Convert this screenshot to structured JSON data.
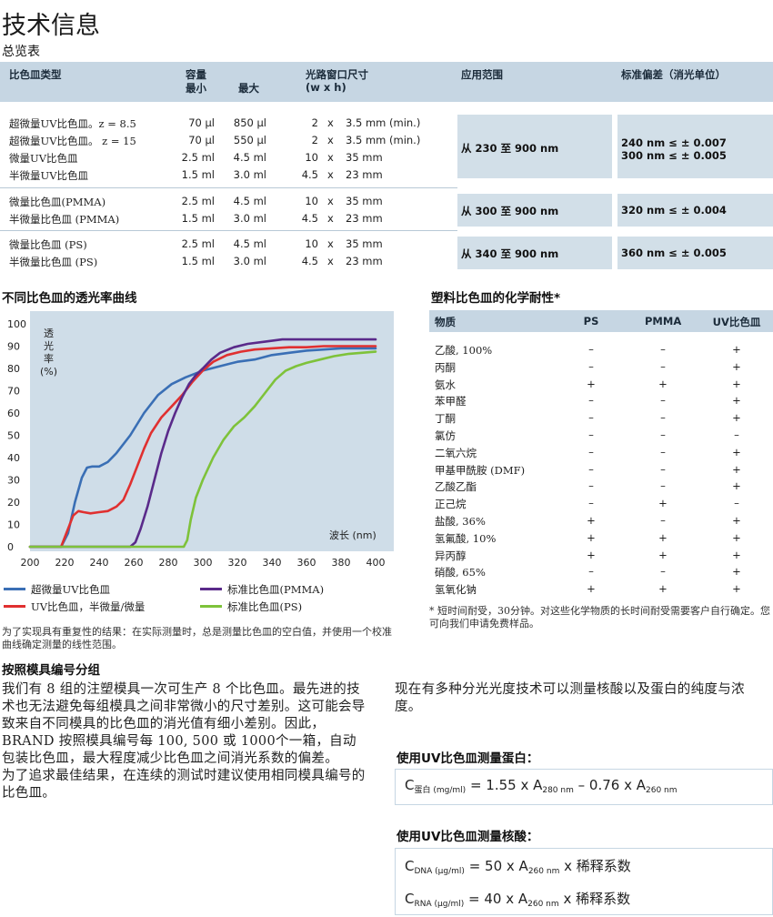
{
  "title": "技术信息",
  "subtitle": "总览表",
  "overview": {
    "headers": {
      "type": "比色皿类型",
      "capacity": "容量",
      "min": "最小",
      "max": "最大",
      "window": "光路窗口尺寸",
      "window_unit": "(w x h)",
      "range": "应用范围",
      "deviation": "标准偏差（消光单位）"
    },
    "rows": [
      {
        "name": "超微量UV比色皿。z = 8.5",
        "min": "70 µl",
        "max": "850 µl",
        "w": "2",
        "x": "x",
        "h": "3.5 mm (min.)"
      },
      {
        "name": "超微量UV比色皿。 z = 15",
        "min": "70 µl",
        "max": "550 µl",
        "w": "2",
        "x": "x",
        "h": "3.5 mm (min.)"
      },
      {
        "name": "微量UV比色皿",
        "min": "2.5 ml",
        "max": "4.5 ml",
        "w": "10",
        "x": "x",
        "h": "35 mm"
      },
      {
        "name": "半微量UV比色皿",
        "min": "1.5 ml",
        "max": "3.0 ml",
        "w": "4.5",
        "x": "x",
        "h": "23 mm"
      },
      {
        "name": "微量比色皿(PMMA)",
        "min": "2.5 ml",
        "max": "4.5 ml",
        "w": "10",
        "x": "x",
        "h": "35 mm"
      },
      {
        "name": "半微量比色皿 (PMMA)",
        "min": "1.5 ml",
        "max": "3.0 ml",
        "w": "4.5",
        "x": "x",
        "h": "23 mm"
      },
      {
        "name": "微量比色皿 (PS)",
        "min": "2.5 ml",
        "max": "4.5 ml",
        "w": "10",
        "x": "x",
        "h": "35 mm"
      },
      {
        "name": "半微量比色皿 (PS)",
        "min": "1.5 ml",
        "max": "3.0 ml",
        "w": "4.5",
        "x": "x",
        "h": "23 mm"
      }
    ],
    "groups": [
      {
        "range": "从 230 至 900 nm",
        "dev1": "240 nm ≤ ± 0.007",
        "dev2": "300 nm ≤ ± 0.005"
      },
      {
        "range": "从 300 至 900 nm",
        "dev1": "320 nm ≤ ± 0.004",
        "dev2": ""
      },
      {
        "range": "从 340 至 900 nm",
        "dev1": "360 nm ≤ ± 0.005",
        "dev2": ""
      }
    ]
  },
  "chart_heading": "不同比色皿的透光率曲线",
  "chart_note": "为了实现具有重复性的结果：在实际测量时，总是测量比色皿的空白值，并使用一个校准曲线确定测量的线性范围。",
  "chart_data": {
    "type": "line",
    "ylabel_lines": [
      "透",
      "光",
      "率",
      "(%)"
    ],
    "xlabel": "波长 (nm)",
    "xlim": [
      200,
      400
    ],
    "ylim": [
      0,
      100
    ],
    "xticks": [
      "200",
      "220",
      "240",
      "260",
      "280",
      "300",
      "320",
      "340",
      "360",
      "380",
      "400"
    ],
    "yticks": [
      "0",
      "10",
      "20",
      "30",
      "40",
      "50",
      "60",
      "70",
      "80",
      "90",
      "100"
    ],
    "series": [
      {
        "name": "超微量UV比色皿",
        "color": "#3a6fb5",
        "points": [
          [
            200,
            0
          ],
          [
            218,
            0
          ],
          [
            222,
            6
          ],
          [
            226,
            20
          ],
          [
            230,
            31
          ],
          [
            233,
            35.5
          ],
          [
            236,
            36
          ],
          [
            240,
            36
          ],
          [
            245,
            38
          ],
          [
            250,
            42
          ],
          [
            258,
            50
          ],
          [
            266,
            60
          ],
          [
            274,
            68
          ],
          [
            282,
            73
          ],
          [
            290,
            76
          ],
          [
            300,
            79
          ],
          [
            310,
            81
          ],
          [
            320,
            83
          ],
          [
            330,
            84
          ],
          [
            340,
            86
          ],
          [
            350,
            87
          ],
          [
            360,
            88
          ],
          [
            370,
            88.5
          ],
          [
            380,
            89
          ],
          [
            390,
            89
          ],
          [
            400,
            89
          ]
        ]
      },
      {
        "name": "UV比色皿，半微量/微量",
        "color": "#e03030",
        "points": [
          [
            200,
            0
          ],
          [
            218,
            0
          ],
          [
            222,
            8
          ],
          [
            225,
            14
          ],
          [
            228,
            16
          ],
          [
            231,
            15.5
          ],
          [
            235,
            15
          ],
          [
            240,
            15.5
          ],
          [
            245,
            16
          ],
          [
            250,
            18
          ],
          [
            254,
            21
          ],
          [
            258,
            28
          ],
          [
            262,
            36
          ],
          [
            266,
            44
          ],
          [
            270,
            51
          ],
          [
            276,
            58
          ],
          [
            282,
            63
          ],
          [
            288,
            68
          ],
          [
            294,
            74
          ],
          [
            300,
            79
          ],
          [
            306,
            83
          ],
          [
            314,
            86
          ],
          [
            322,
            87.5
          ],
          [
            330,
            88.5
          ],
          [
            340,
            89
          ],
          [
            350,
            89.5
          ],
          [
            360,
            89.5
          ],
          [
            370,
            90
          ],
          [
            380,
            90
          ],
          [
            390,
            90
          ],
          [
            400,
            90
          ]
        ]
      },
      {
        "name": "标准比色皿(PMMA)",
        "color": "#5a2a8a",
        "points": [
          [
            200,
            0
          ],
          [
            258,
            0
          ],
          [
            261,
            2
          ],
          [
            264,
            8
          ],
          [
            268,
            18
          ],
          [
            272,
            30
          ],
          [
            276,
            42
          ],
          [
            280,
            52
          ],
          [
            284,
            60
          ],
          [
            288,
            67
          ],
          [
            292,
            73
          ],
          [
            296,
            77
          ],
          [
            300,
            80
          ],
          [
            305,
            84
          ],
          [
            310,
            87
          ],
          [
            318,
            89.5
          ],
          [
            326,
            91
          ],
          [
            336,
            92
          ],
          [
            346,
            93
          ],
          [
            356,
            93
          ],
          [
            366,
            93
          ],
          [
            380,
            93
          ],
          [
            400,
            93
          ]
        ]
      },
      {
        "name": "标准比色皿(PS)",
        "color": "#7ec23a",
        "points": [
          [
            200,
            0
          ],
          [
            289,
            0
          ],
          [
            291,
            3
          ],
          [
            293,
            12
          ],
          [
            296,
            22
          ],
          [
            300,
            30
          ],
          [
            306,
            40
          ],
          [
            312,
            48
          ],
          [
            318,
            54
          ],
          [
            324,
            58
          ],
          [
            330,
            63
          ],
          [
            336,
            69
          ],
          [
            342,
            75
          ],
          [
            348,
            79
          ],
          [
            354,
            81
          ],
          [
            360,
            82.5
          ],
          [
            368,
            84
          ],
          [
            376,
            85.5
          ],
          [
            384,
            86.5
          ],
          [
            392,
            87
          ],
          [
            400,
            87.5
          ]
        ]
      }
    ]
  },
  "resistance": {
    "heading": "塑料比色皿的化学耐性*",
    "headers": {
      "substance": "物质",
      "ps": "PS",
      "pmma": "PMMA",
      "uv": "UV比色皿"
    },
    "rows": [
      {
        "name": "乙酸, 100%",
        "ps": "–",
        "pmma": "–",
        "uv": "+"
      },
      {
        "name": "丙酮",
        "ps": "–",
        "pmma": "–",
        "uv": "+"
      },
      {
        "name": "氨水",
        "ps": "+",
        "pmma": "+",
        "uv": "+"
      },
      {
        "name": "苯甲醛",
        "ps": "–",
        "pmma": "–",
        "uv": "+"
      },
      {
        "name": "丁酮",
        "ps": "–",
        "pmma": "–",
        "uv": "+"
      },
      {
        "name": "氯仿",
        "ps": "–",
        "pmma": "–",
        "uv": "–"
      },
      {
        "name": "二氧六烷",
        "ps": "–",
        "pmma": "–",
        "uv": "+"
      },
      {
        "name": "甲基甲酰胺 (DMF)",
        "ps": "–",
        "pmma": "–",
        "uv": "+"
      },
      {
        "name": "乙酸乙酯",
        "ps": "–",
        "pmma": "–",
        "uv": "+"
      },
      {
        "name": "正己烷",
        "ps": "–",
        "pmma": "+",
        "uv": "–"
      },
      {
        "name": "盐酸, 36%",
        "ps": "+",
        "pmma": "–",
        "uv": "+"
      },
      {
        "name": "氢氟酸, 10%",
        "ps": "+",
        "pmma": "+",
        "uv": "+"
      },
      {
        "name": "异丙醇",
        "ps": "+",
        "pmma": "+",
        "uv": "+"
      },
      {
        "name": "硝酸, 65%",
        "ps": "–",
        "pmma": "–",
        "uv": "+"
      },
      {
        "name": "氢氧化钠",
        "ps": "+",
        "pmma": "+",
        "uv": "+"
      }
    ],
    "note": "* 短时间耐受，30分钟。对这些化学物质的长时间耐受需要客户自行确定。您可向我们申请免费样品。"
  },
  "molds": {
    "heading": "按照模具编号分组",
    "p1": "我们有 8 组的注塑模具一次可生产 8 个比色皿。最先进的技术也无法避免每组模具之间非常微小的尺寸差别。这可能会导致来自不同模具的比色皿的消光值有细小差别。因此，BRAND 按照模具编号每 100, 500 或 1000个一箱，自动包装比色皿，最大程度减少比色皿之间消光系数的偏差。",
    "p2": "为了追求最佳结果，在连续的测试时建议使用相同模具编号的比色皿。"
  },
  "photometry": {
    "intro": "现在有多种分光光度技术可以测量核酸以及蛋白的纯度与浓度。",
    "protein_heading": "使用UV比色皿测量蛋白：",
    "protein_formula": {
      "c": "C",
      "c_sub": "蛋白 (mg/ml)",
      "eq": "= 1.55 x A",
      "a1_sub": "280 nm",
      "minus": "– 0.76 x A",
      "a2_sub": "260 nm"
    },
    "nucleic_heading": "使用UV比色皿测量核酸：",
    "dna_formula": {
      "c": "C",
      "c_sub": "DNA (µg/ml)",
      "eq": "= 50 x A",
      "a_sub": "260 nm",
      "tail": "x 稀释系数"
    },
    "rna_formula": {
      "c": "C",
      "c_sub": "RNA (µg/ml)",
      "eq": "= 40 x A",
      "a_sub": "260 nm",
      "tail": "x 稀释系数"
    }
  }
}
